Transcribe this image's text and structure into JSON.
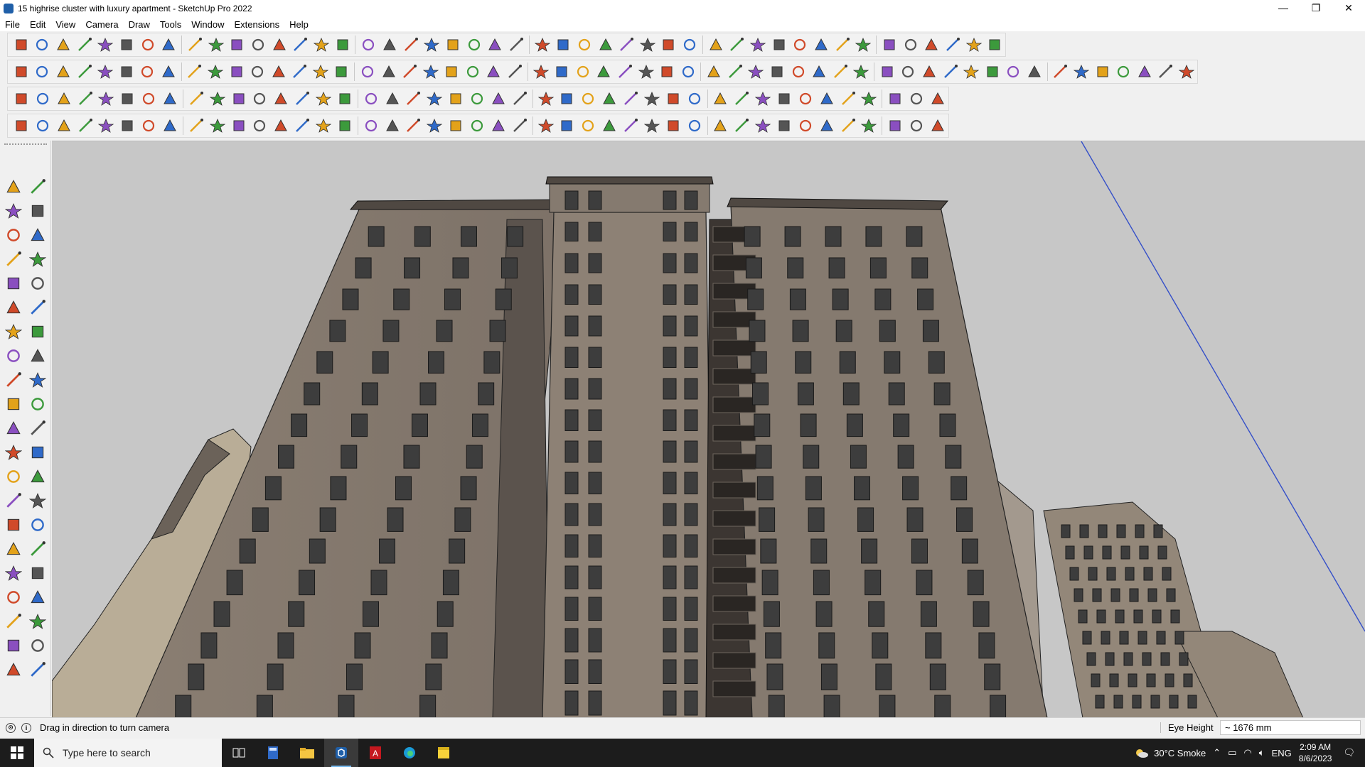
{
  "window": {
    "title": "15 highrise cluster with luxury apartment - SketchUp Pro 2022",
    "minimize_glyph": "—",
    "restore_glyph": "❐",
    "close_glyph": "✕"
  },
  "menu": [
    "File",
    "Edit",
    "View",
    "Camera",
    "Draw",
    "Tools",
    "Window",
    "Extensions",
    "Help"
  ],
  "toolbars": {
    "row1_icons": [
      "zoom-icon",
      "select-icon",
      "eraser-icon",
      "line-icon",
      "arc-icon",
      "rectangle-icon",
      "push-pull-icon",
      "follow-me-icon",
      "move-icon",
      "rotate-icon",
      "scale-icon",
      "tape-measure-icon",
      "text-icon",
      "paint-bucket-icon",
      "orbit-icon",
      "pan-icon",
      "zoom-window-icon",
      "zoom-extents-icon",
      "position-camera-icon",
      "walk-icon",
      "look-around-icon",
      "section-plane-icon",
      "profile-icon",
      "axes-icon",
      "undo-icon",
      "redo-icon"
    ],
    "row2_icons": [
      "component-icon",
      "group-icon",
      "make-component-icon",
      "3d-text-icon",
      "move-up-icon",
      "move-down-icon",
      "sandbox-icon",
      "house-icon",
      "floorplan-icon",
      "roof-icon",
      "door-icon",
      "measure-icon",
      "polygon-icon",
      "circle-icon",
      "freehand-icon"
    ],
    "row3_icons": [
      "sandbox-from-contours-icon",
      "from-scratch-icon",
      "smoove-icon",
      "stamp-icon",
      "drape-icon",
      "add-detail-icon",
      "flip-edge-icon",
      "undo-history-icon",
      "delete-icon",
      "grid-icon",
      "intersect-icon",
      "solid-tools-icon"
    ],
    "row4_icons": [
      "weld-icon",
      "curve-icon",
      "bezier-icon",
      "spline-icon",
      "loft-icon",
      "extrude-icon",
      "fillet-icon",
      "chamfer-icon",
      "stair-icon",
      "railing-icon",
      "louver-icon",
      "roof-tool-icon"
    ]
  },
  "left_palette_icons": [
    "select-icon",
    "orbit-icon",
    "paint-bucket-icon",
    "eraser-icon",
    "component-icon",
    "pencil-icon",
    "line-icon",
    "freehand-icon",
    "rectangle-icon",
    "rotated-rect-icon",
    "circle-icon",
    "polygon-icon",
    "arc-icon",
    "pie-icon",
    "3pt-arc-icon",
    "2pt-arc-icon",
    "move-icon",
    "push-pull-icon",
    "rotate-icon",
    "follow-me-icon",
    "scale-icon",
    "offset-icon",
    "tape-measure-icon",
    "dimension-icon",
    "protractor-icon",
    "text-icon",
    "axes-icon",
    "3d-text-icon",
    "orbit-icon",
    "pan-icon",
    "zoom-icon",
    "zoom-window-icon",
    "zoom-extents-icon",
    "previous-view-icon",
    "position-camera-icon",
    "look-around-icon",
    "walk-icon",
    "section-plane-icon",
    "section-display-icon",
    "section-cut-icon",
    "section-fill-icon",
    "layers-icon"
  ],
  "status": {
    "message": "Drag in direction to turn camera",
    "measurement_label": "Eye Height",
    "measurement_value": "~ 1676 mm"
  },
  "taskbar": {
    "search_placeholder": "Type here to search",
    "weather": "30°C  Smoke",
    "language": "ENG",
    "time": "2:09 AM",
    "date": "8/6/2023"
  },
  "colors": {
    "sky": "#c7c7c7",
    "facade": "#8a7e72",
    "facade_dark": "#5e5650",
    "window_glass": "#3d3d3d",
    "accent_blue": "#1f5fa8"
  }
}
